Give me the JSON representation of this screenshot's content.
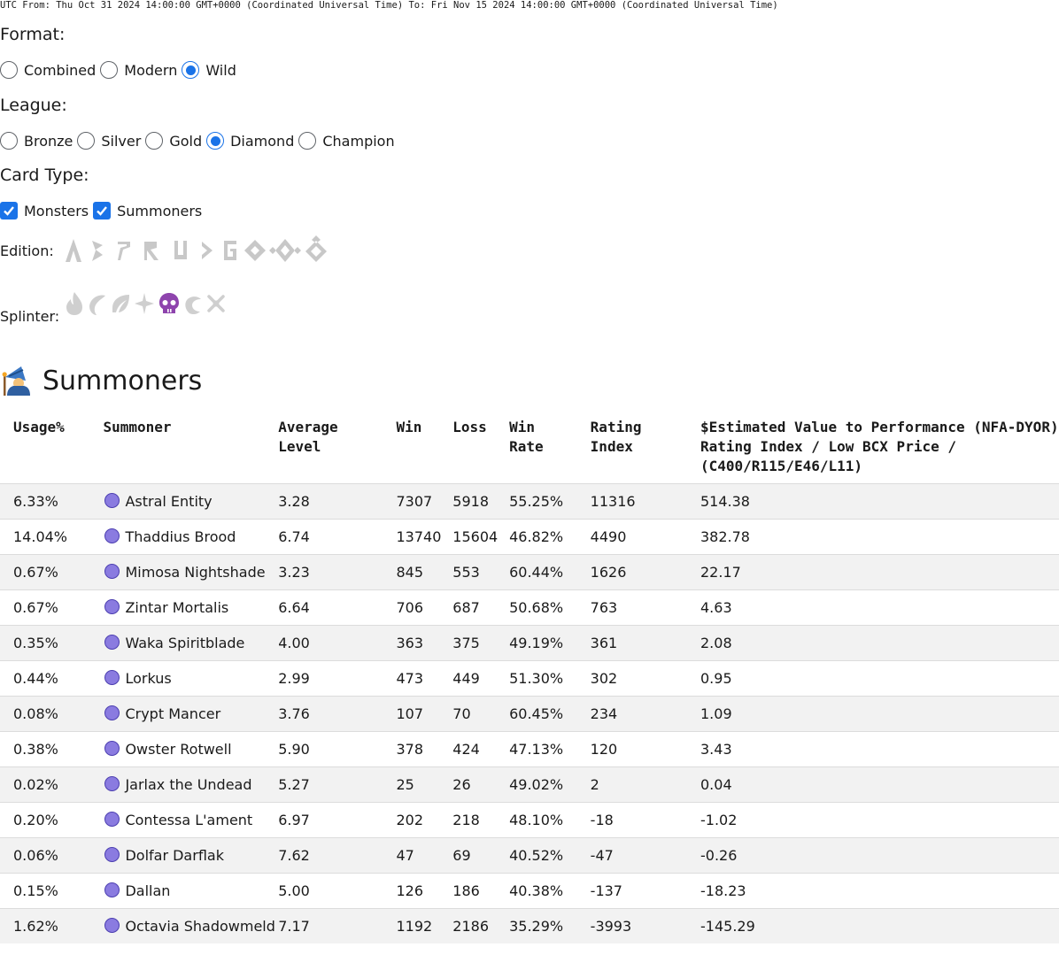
{
  "date_range": "UTC From: Thu Oct 31 2024 14:00:00 GMT+0000 (Coordinated Universal Time) To: Fri Nov 15 2024 14:00:00 GMT+0000 (Coordinated Universal Time)",
  "format": {
    "label": "Format:",
    "options": [
      "Combined",
      "Modern",
      "Wild"
    ],
    "selected": "Wild"
  },
  "league": {
    "label": "League:",
    "options": [
      "Bronze",
      "Silver",
      "Gold",
      "Diamond",
      "Champion"
    ],
    "selected": "Diamond"
  },
  "card_type": {
    "label": "Card Type:",
    "options": [
      {
        "label": "Monsters",
        "checked": true
      },
      {
        "label": "Summoners",
        "checked": true
      }
    ]
  },
  "edition": {
    "label": "Edition:",
    "icons": [
      "alpha-edition-icon",
      "beta-edition-icon",
      "promo-edition-icon",
      "reward-edition-icon",
      "untamed-edition-icon",
      "dice-edition-icon",
      "gladius-edition-icon",
      "chaos-edition-icon",
      "rift-edition-icon",
      "soulbound-edition-icon"
    ]
  },
  "splinter": {
    "label": "Splinter:",
    "icons": [
      "fire-splinter-icon",
      "water-splinter-icon",
      "earth-splinter-icon",
      "life-splinter-icon",
      "death-splinter-icon",
      "dragon-splinter-icon",
      "neutral-splinter-icon"
    ],
    "selected": "death-splinter-icon",
    "selected_color": "#8e44ad"
  },
  "summoners": {
    "title": "Summoners",
    "icon": "wizard-icon",
    "columns": {
      "usage": "Usage%",
      "summoner": "Summoner",
      "avg_level": "Average Level",
      "win": "Win",
      "loss": "Loss",
      "win_rate": "Win Rate",
      "rating": "Rating Index",
      "value": "$Estimated Value to Performance (NFA-DYOR) Rating Index / Low BCX Price / (C400/R115/E46/L11)"
    },
    "splinter_dot_color": "#8a7be0",
    "rows": [
      {
        "usage": "6.33%",
        "name": "Astral Entity",
        "level": "3.28",
        "win": "7307",
        "loss": "5918",
        "rate": "55.25%",
        "rating": "11316",
        "value": "514.38"
      },
      {
        "usage": "14.04%",
        "name": "Thaddius Brood",
        "level": "6.74",
        "win": "13740",
        "loss": "15604",
        "rate": "46.82%",
        "rating": "4490",
        "value": "382.78"
      },
      {
        "usage": "0.67%",
        "name": "Mimosa Nightshade",
        "level": "3.23",
        "win": "845",
        "loss": "553",
        "rate": "60.44%",
        "rating": "1626",
        "value": "22.17"
      },
      {
        "usage": "0.67%",
        "name": "Zintar Mortalis",
        "level": "6.64",
        "win": "706",
        "loss": "687",
        "rate": "50.68%",
        "rating": "763",
        "value": "4.63"
      },
      {
        "usage": "0.35%",
        "name": "Waka Spiritblade",
        "level": "4.00",
        "win": "363",
        "loss": "375",
        "rate": "49.19%",
        "rating": "361",
        "value": "2.08"
      },
      {
        "usage": "0.44%",
        "name": "Lorkus",
        "level": "2.99",
        "win": "473",
        "loss": "449",
        "rate": "51.30%",
        "rating": "302",
        "value": "0.95"
      },
      {
        "usage": "0.08%",
        "name": "Crypt Mancer",
        "level": "3.76",
        "win": "107",
        "loss": "70",
        "rate": "60.45%",
        "rating": "234",
        "value": "1.09"
      },
      {
        "usage": "0.38%",
        "name": "Owster Rotwell",
        "level": "5.90",
        "win": "378",
        "loss": "424",
        "rate": "47.13%",
        "rating": "120",
        "value": "3.43"
      },
      {
        "usage": "0.02%",
        "name": "Jarlax the Undead",
        "level": "5.27",
        "win": "25",
        "loss": "26",
        "rate": "49.02%",
        "rating": "2",
        "value": "0.04"
      },
      {
        "usage": "0.20%",
        "name": "Contessa L'ament",
        "level": "6.97",
        "win": "202",
        "loss": "218",
        "rate": "48.10%",
        "rating": "-18",
        "value": "-1.02"
      },
      {
        "usage": "0.06%",
        "name": "Dolfar Darflak",
        "level": "7.62",
        "win": "47",
        "loss": "69",
        "rate": "40.52%",
        "rating": "-47",
        "value": "-0.26"
      },
      {
        "usage": "0.15%",
        "name": "Dallan",
        "level": "5.00",
        "win": "126",
        "loss": "186",
        "rate": "40.38%",
        "rating": "-137",
        "value": "-18.23"
      },
      {
        "usage": "1.62%",
        "name": "Octavia Shadowmeld",
        "level": "7.17",
        "win": "1192",
        "loss": "2186",
        "rate": "35.29%",
        "rating": "-3993",
        "value": "-145.29"
      }
    ]
  }
}
